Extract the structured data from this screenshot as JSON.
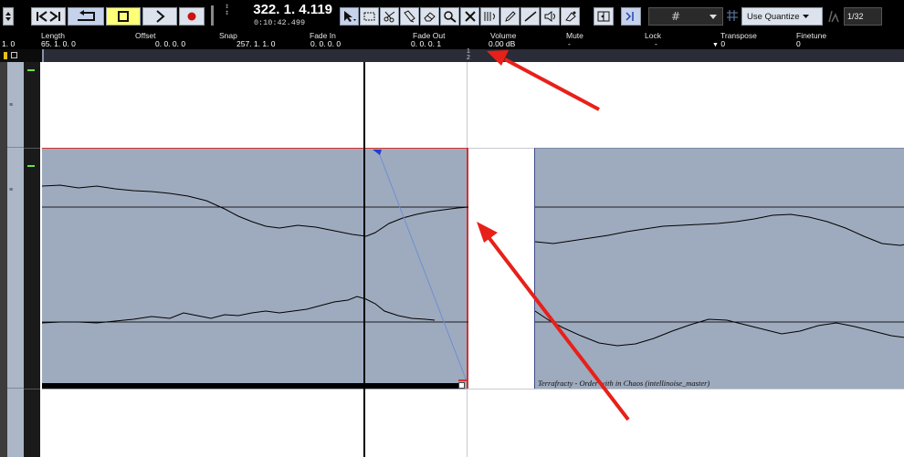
{
  "transport": {
    "position_bars": "322. 1. 4.119",
    "position_time": "0:10:42.499"
  },
  "toolbar": {
    "quantize_label": "Use Quantize",
    "quantize_value": "1/32",
    "grid_glyph": "#"
  },
  "infoline": {
    "start_value": "1. 0",
    "fields": [
      {
        "label": "Length",
        "value": "65. 1. 0. 0"
      },
      {
        "label": "Offset",
        "value": "0. 0. 0. 0"
      },
      {
        "label": "Snap",
        "value": "257. 1. 1. 0"
      },
      {
        "label": "Fade In",
        "value": "0. 0. 0. 0"
      },
      {
        "label": "Fade Out",
        "value": "0. 0. 0. 1"
      },
      {
        "label": "Volume",
        "value": "0.00 dB"
      },
      {
        "label": "Mute",
        "value": "-"
      },
      {
        "label": "Lock",
        "value": "-"
      },
      {
        "label": "Transpose",
        "value": "0"
      },
      {
        "label": "Finetune",
        "value": "0"
      }
    ]
  },
  "ruler": {
    "marker_1": "1",
    "marker_2": "2"
  },
  "events": {
    "event_2_name": "Terrafracty - Order with in Chaos (intellinoise_master)"
  },
  "colors": {
    "event_fill": "#9eabbe",
    "selected_border": "#d23232",
    "annotation_arrow": "#e8201a",
    "toolbar_bg": "#000000",
    "quantize_button": "#dde3ec"
  },
  "icons": {
    "go_to_start": "skip-to-start-icon",
    "cycle": "cycle-icon",
    "stop": "stop-icon",
    "play": "play-icon",
    "record": "record-icon",
    "object_selection": "pointer-icon",
    "range_selection": "range-icon",
    "split": "scissors-icon",
    "glue": "glue-icon",
    "erase": "eraser-icon",
    "zoom": "zoom-icon",
    "mute": "mute-x-icon",
    "time_warp": "time-warp-icon",
    "draw": "pencil-icon",
    "line": "line-icon",
    "play_tool": "speaker-icon",
    "color": "color-icon"
  }
}
